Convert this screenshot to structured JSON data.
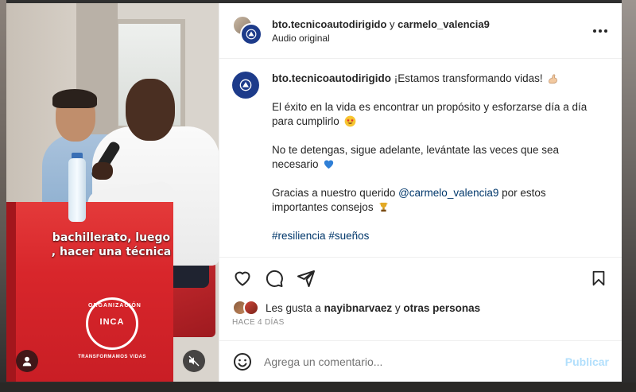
{
  "video": {
    "caption_line1": "bachillerato, luego",
    "caption_line2": ", hacer una técnica",
    "logo_arc": "ORGANIZACIÓN",
    "logo_name": "INCA",
    "logo_tagline": "TRANSFORMAMOS VIDAS"
  },
  "header": {
    "user1": "bto.tecnicoautodirigido",
    "joiner": " y ",
    "user2": "carmelo_valencia9",
    "subtitle": "Audio original"
  },
  "caption": {
    "username": "bto.tecnicoautodirigido",
    "line1": "¡Estamos transformando vidas!",
    "para2": "El éxito en la vida es encontrar un propósito y esforzarse día a día para cumplirlo",
    "para3": "No te detengas, sigue adelante, levántate las veces que sea necesario",
    "para4_pre": "Gracias a nuestro querido ",
    "para4_mention": "@carmelo_valencia9",
    "para4_post": " por estos importantes consejos",
    "hashtag1": "#resiliencia",
    "hashtag2": "#sueños"
  },
  "likes": {
    "prefix": "Les gusta a ",
    "user": "nayibnarvaez",
    "mid": " y ",
    "others": "otras personas"
  },
  "time_ago": "HACE 4 DÍAS",
  "comment": {
    "placeholder": "Agrega un comentario...",
    "publish_label": "Publicar"
  },
  "colors": {
    "brand_blue": "#1d3b8a",
    "link": "#00376b",
    "publish_disabled": "#b2dffc"
  }
}
